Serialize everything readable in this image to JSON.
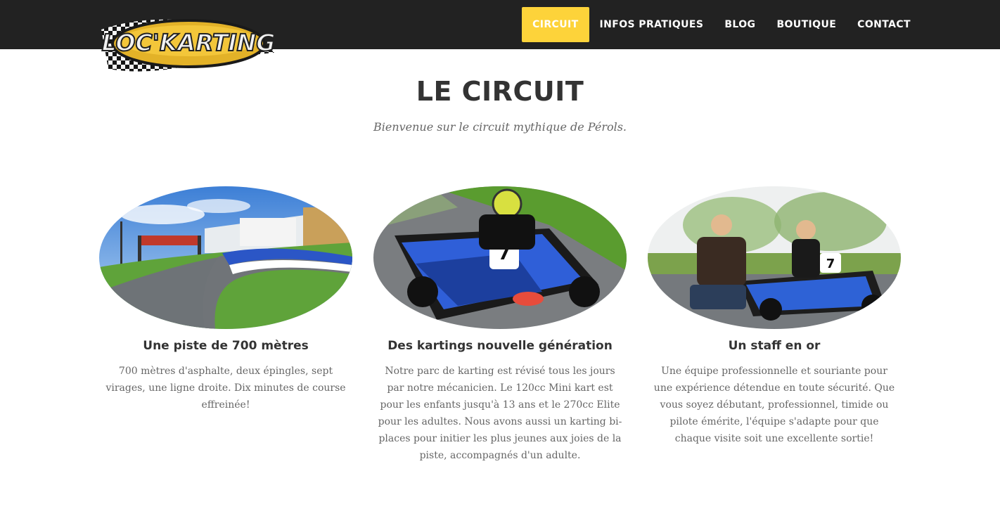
{
  "logo": {
    "text": "LOC'KARTING"
  },
  "nav": {
    "items": [
      {
        "label": "CIRCUIT",
        "active": true
      },
      {
        "label": "INFOS PRATIQUES",
        "active": false
      },
      {
        "label": "BLOG",
        "active": false
      },
      {
        "label": "BOUTIQUE",
        "active": false
      },
      {
        "label": "CONTACT",
        "active": false
      }
    ]
  },
  "header": {
    "title": "LE CIRCUIT",
    "subtitle": "Bienvenue sur le circuit mythique de Pérols."
  },
  "features": [
    {
      "title": "Une piste de 700 mètres",
      "text": "700 mètres d'asphalte, deux épingles, sept virages, une ligne droite. Dix minutes de course effreinée!"
    },
    {
      "title": "Des kartings nouvelle génération",
      "text": "Notre parc de karting est révisé tous les jours par notre mécanicien. Le 120cc Mini kart est pour les enfants jusqu'à 13 ans et le 270cc Elite pour les adultes. Nous avons aussi un karting bi-places pour initier les plus jeunes aux joies de la piste, accompagnés d'un adulte."
    },
    {
      "title": "Un staff en or",
      "text": "Une équipe professionnelle et souriante pour une expérience détendue en toute sécurité. Que vous soyez débutant, professionnel, timide ou pilote émérite, l'équipe s'adapte pour que chaque visite soit une excellente sortie!"
    }
  ],
  "colors": {
    "topbar": "#222222",
    "accent": "#fdd33a",
    "heading": "#333333",
    "body_text": "#666666"
  }
}
